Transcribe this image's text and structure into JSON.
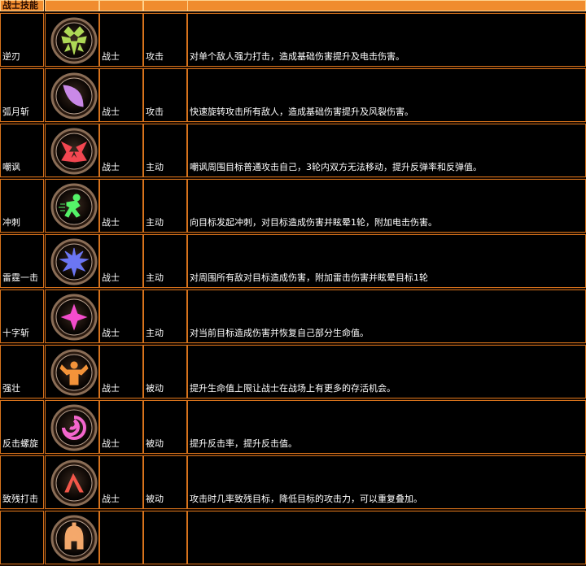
{
  "table": {
    "header": {
      "title": "战士技能",
      "col2": "",
      "col3": "",
      "col4": ""
    },
    "rows": [
      {
        "name": "逆刃",
        "class": "战士",
        "type": "攻击",
        "desc": "对单个敌人强力打击，造成基础伤害提升及电击伤害。",
        "icon": "winged-bug-icon",
        "color": "#b6e35a"
      },
      {
        "name": "弧月斩",
        "class": "战士",
        "type": "攻击",
        "desc": "快速旋转攻击所有敌人，造成基础伤害提升及风裂伤害。",
        "icon": "crescent-slash-icon",
        "color": "#d28ff2"
      },
      {
        "name": "嘲讽",
        "class": "战士",
        "type": "主动",
        "desc": "嘲讽周围目标普通攻击自己，3轮内双方无法移动，提升反弹率和反弹值。",
        "icon": "red-mask-icon",
        "color": "#ff4a55"
      },
      {
        "name": "冲刺",
        "class": "战士",
        "type": "主动",
        "desc": "向目标发起冲刺，对目标造成伤害并眩晕1轮，附加电击伤害。",
        "icon": "sprinting-man-icon",
        "color": "#57ff6d"
      },
      {
        "name": "雷霆一击",
        "class": "战士",
        "type": "主动",
        "desc": "对周围所有敌对目标造成伤害，附加雷击伤害并眩晕目标1轮",
        "icon": "lightning-burst-icon",
        "color": "#6f7bff"
      },
      {
        "name": "十字斩",
        "class": "战士",
        "type": "主动",
        "desc": "对当前目标造成伤害并恢复自己部分生命值。",
        "icon": "cross-star-icon",
        "color": "#ff4fd6"
      },
      {
        "name": "强壮",
        "class": "战士",
        "type": "被动",
        "desc": "提升生命值上限让战士在战场上有更多的存活机会。",
        "icon": "strongman-icon",
        "color": "#ff9a3c"
      },
      {
        "name": "反击螺旋",
        "class": "战士",
        "type": "被动",
        "desc": "提升反击率，提升反击值。",
        "icon": "spiral-icon",
        "color": "#ff6ad8"
      },
      {
        "name": "致残打击",
        "class": "战士",
        "type": "被动",
        "desc": "攻击时几率致残目标，降低目标的攻击力，可以重复叠加。",
        "icon": "bent-blade-icon",
        "color": "#ff5a4d"
      },
      {
        "name": "",
        "class": "",
        "type": "",
        "desc": "",
        "icon": "spartan-helmet-icon",
        "color": "#ffb070"
      }
    ]
  }
}
